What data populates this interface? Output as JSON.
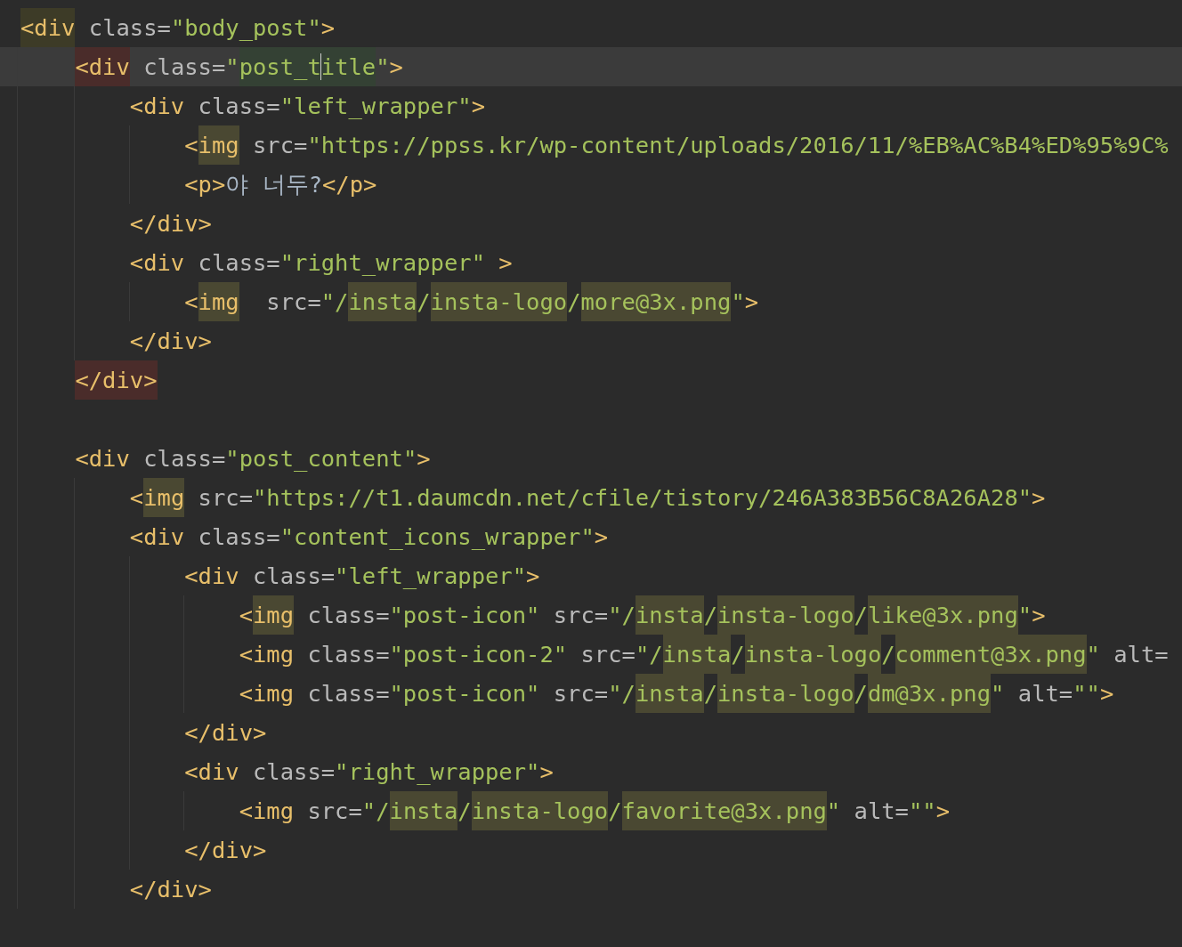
{
  "editor": {
    "lines": [
      {
        "current": false,
        "tokens": [
          {
            "kind": "tag",
            "text": "<div",
            "color": "#3d3b27"
          },
          {
            "kind": "attr",
            "text": " class="
          },
          {
            "kind": "str",
            "text": "\"body_post\""
          },
          {
            "kind": "tag",
            "text": ">"
          }
        ],
        "children": [
          {
            "current": true,
            "tokens": [
              {
                "kind": "tag",
                "text": "<div",
                "color": "#4a2c2a"
              },
              {
                "kind": "attr",
                "text": " class="
              },
              {
                "kind": "str",
                "text": "\""
              },
              {
                "kind": "str",
                "text": "post_t",
                "color": "#344134"
              },
              {
                "kind": "caret"
              },
              {
                "kind": "str",
                "text": "itle",
                "color": "#344134"
              },
              {
                "kind": "str",
                "text": "\""
              },
              {
                "kind": "tag",
                "text": ">"
              }
            ],
            "children": [
              {
                "current": false,
                "tokens": [
                  {
                    "kind": "tag",
                    "text": "<div"
                  },
                  {
                    "kind": "attr",
                    "text": " class="
                  },
                  {
                    "kind": "str",
                    "text": "\"left_wrapper\""
                  },
                  {
                    "kind": "tag",
                    "text": ">"
                  }
                ],
                "children": [
                  {
                    "current": false,
                    "tokens": [
                      {
                        "kind": "tag",
                        "text": "<"
                      },
                      {
                        "kind": "tag",
                        "text": "img",
                        "color": "#4a4832"
                      },
                      {
                        "kind": "attr",
                        "text": " src="
                      },
                      {
                        "kind": "str",
                        "text": "\"https://ppss.kr/wp-content/uploads/2016/11/%EB%AC%B4%ED%95%9C%"
                      }
                    ]
                  },
                  {
                    "current": false,
                    "tokens": [
                      {
                        "kind": "tag",
                        "text": "<p>"
                      },
                      {
                        "kind": "text",
                        "text": "야 너두?"
                      },
                      {
                        "kind": "tag",
                        "text": "</p>"
                      }
                    ]
                  }
                ]
              },
              {
                "current": false,
                "tokens": [
                  {
                    "kind": "tag",
                    "text": "</div>"
                  }
                ]
              },
              {
                "current": false,
                "tokens": [
                  {
                    "kind": "tag",
                    "text": "<div"
                  },
                  {
                    "kind": "attr",
                    "text": " class="
                  },
                  {
                    "kind": "str",
                    "text": "\"right_wrapper\""
                  },
                  {
                    "kind": "tag",
                    "text": " >"
                  }
                ],
                "children": [
                  {
                    "current": false,
                    "tokens": [
                      {
                        "kind": "tag",
                        "text": "<"
                      },
                      {
                        "kind": "tag",
                        "text": "img",
                        "color": "#4a4832"
                      },
                      {
                        "kind": "attr",
                        "text": "  src="
                      },
                      {
                        "kind": "str",
                        "text": "\"/"
                      },
                      {
                        "kind": "str",
                        "text": "insta",
                        "color": "#4a4832"
                      },
                      {
                        "kind": "str",
                        "text": "/"
                      },
                      {
                        "kind": "str",
                        "text": "insta-logo",
                        "color": "#4a4832"
                      },
                      {
                        "kind": "str",
                        "text": "/"
                      },
                      {
                        "kind": "str",
                        "text": "more@3x.png",
                        "color": "#4a4832"
                      },
                      {
                        "kind": "str",
                        "text": "\""
                      },
                      {
                        "kind": "tag",
                        "text": ">"
                      }
                    ]
                  }
                ]
              },
              {
                "current": false,
                "tokens": [
                  {
                    "kind": "tag",
                    "text": "</div>"
                  }
                ]
              }
            ]
          },
          {
            "current": false,
            "tokens": [
              {
                "kind": "tag",
                "text": "</div>",
                "color": "#4a2c2a"
              }
            ]
          },
          {
            "current": false
          },
          {
            "current": false,
            "tokens": [
              {
                "kind": "tag",
                "text": "<div"
              },
              {
                "kind": "attr",
                "text": " class="
              },
              {
                "kind": "str",
                "text": "\"post_content\""
              },
              {
                "kind": "tag",
                "text": ">"
              }
            ],
            "children": [
              {
                "current": false,
                "tokens": [
                  {
                    "kind": "tag",
                    "text": "<"
                  },
                  {
                    "kind": "tag",
                    "text": "img",
                    "color": "#4a4832"
                  },
                  {
                    "kind": "attr",
                    "text": " src="
                  },
                  {
                    "kind": "str",
                    "text": "\"https://t1.daumcdn.net/cfile/tistory/246A383B56C8A26A28\""
                  },
                  {
                    "kind": "tag",
                    "text": ">"
                  }
                ]
              },
              {
                "current": false,
                "tokens": [
                  {
                    "kind": "tag",
                    "text": "<div"
                  },
                  {
                    "kind": "attr",
                    "text": " class="
                  },
                  {
                    "kind": "str",
                    "text": "\"content_icons_wrapper\""
                  },
                  {
                    "kind": "tag",
                    "text": ">"
                  }
                ],
                "children": [
                  {
                    "current": false,
                    "tokens": [
                      {
                        "kind": "tag",
                        "text": "<div"
                      },
                      {
                        "kind": "attr",
                        "text": " class="
                      },
                      {
                        "kind": "str",
                        "text": "\"left_wrapper\""
                      },
                      {
                        "kind": "tag",
                        "text": ">"
                      }
                    ],
                    "children": [
                      {
                        "current": false,
                        "tokens": [
                          {
                            "kind": "tag",
                            "text": "<"
                          },
                          {
                            "kind": "tag",
                            "text": "img",
                            "color": "#4a4832"
                          },
                          {
                            "kind": "attr",
                            "text": " class="
                          },
                          {
                            "kind": "str",
                            "text": "\"post-icon\""
                          },
                          {
                            "kind": "attr",
                            "text": " src="
                          },
                          {
                            "kind": "str",
                            "text": "\"/"
                          },
                          {
                            "kind": "str",
                            "text": "insta",
                            "color": "#4a4832"
                          },
                          {
                            "kind": "str",
                            "text": "/"
                          },
                          {
                            "kind": "str",
                            "text": "insta-logo",
                            "color": "#4a4832"
                          },
                          {
                            "kind": "str",
                            "text": "/"
                          },
                          {
                            "kind": "str",
                            "text": "like@3x.png",
                            "color": "#4a4832"
                          },
                          {
                            "kind": "str",
                            "text": "\""
                          },
                          {
                            "kind": "tag",
                            "text": ">"
                          }
                        ]
                      },
                      {
                        "current": false,
                        "tokens": [
                          {
                            "kind": "tag",
                            "text": "<img"
                          },
                          {
                            "kind": "attr",
                            "text": " class="
                          },
                          {
                            "kind": "str",
                            "text": "\"post-icon-2\""
                          },
                          {
                            "kind": "attr",
                            "text": " src="
                          },
                          {
                            "kind": "str",
                            "text": "\"/"
                          },
                          {
                            "kind": "str",
                            "text": "insta",
                            "color": "#4a4832"
                          },
                          {
                            "kind": "str",
                            "text": "/"
                          },
                          {
                            "kind": "str",
                            "text": "insta-logo",
                            "color": "#4a4832"
                          },
                          {
                            "kind": "str",
                            "text": "/"
                          },
                          {
                            "kind": "str",
                            "text": "comment@3x.png",
                            "color": "#4a4832"
                          },
                          {
                            "kind": "str",
                            "text": "\""
                          },
                          {
                            "kind": "attr",
                            "text": " alt="
                          }
                        ]
                      },
                      {
                        "current": false,
                        "tokens": [
                          {
                            "kind": "tag",
                            "text": "<img"
                          },
                          {
                            "kind": "attr",
                            "text": " class="
                          },
                          {
                            "kind": "str",
                            "text": "\"post-icon\""
                          },
                          {
                            "kind": "attr",
                            "text": " src="
                          },
                          {
                            "kind": "str",
                            "text": "\"/"
                          },
                          {
                            "kind": "str",
                            "text": "insta",
                            "color": "#4a4832"
                          },
                          {
                            "kind": "str",
                            "text": "/"
                          },
                          {
                            "kind": "str",
                            "text": "insta-logo",
                            "color": "#4a4832"
                          },
                          {
                            "kind": "str",
                            "text": "/"
                          },
                          {
                            "kind": "str",
                            "text": "dm@3x.png",
                            "color": "#4a4832"
                          },
                          {
                            "kind": "str",
                            "text": "\""
                          },
                          {
                            "kind": "attr",
                            "text": " alt="
                          },
                          {
                            "kind": "str",
                            "text": "\"\""
                          },
                          {
                            "kind": "tag",
                            "text": ">"
                          }
                        ]
                      }
                    ]
                  },
                  {
                    "current": false,
                    "tokens": [
                      {
                        "kind": "tag",
                        "text": "</div>"
                      }
                    ]
                  },
                  {
                    "current": false,
                    "tokens": [
                      {
                        "kind": "tag",
                        "text": "<div"
                      },
                      {
                        "kind": "attr",
                        "text": " class="
                      },
                      {
                        "kind": "str",
                        "text": "\"right_wrapper\""
                      },
                      {
                        "kind": "tag",
                        "text": ">"
                      }
                    ],
                    "children": [
                      {
                        "current": false,
                        "tokens": [
                          {
                            "kind": "tag",
                            "text": "<img"
                          },
                          {
                            "kind": "attr",
                            "text": " src="
                          },
                          {
                            "kind": "str",
                            "text": "\"/"
                          },
                          {
                            "kind": "str",
                            "text": "insta",
                            "color": "#4a4832"
                          },
                          {
                            "kind": "str",
                            "text": "/"
                          },
                          {
                            "kind": "str",
                            "text": "insta-logo",
                            "color": "#4a4832"
                          },
                          {
                            "kind": "str",
                            "text": "/"
                          },
                          {
                            "kind": "str",
                            "text": "favorite@3x.png",
                            "color": "#4a4832"
                          },
                          {
                            "kind": "str",
                            "text": "\""
                          },
                          {
                            "kind": "attr",
                            "text": " alt="
                          },
                          {
                            "kind": "str",
                            "text": "\"\""
                          },
                          {
                            "kind": "tag",
                            "text": ">"
                          }
                        ]
                      }
                    ]
                  },
                  {
                    "current": false,
                    "tokens": [
                      {
                        "kind": "tag",
                        "text": "</div>"
                      }
                    ]
                  }
                ]
              },
              {
                "current": false,
                "tokens": [
                  {
                    "kind": "tag",
                    "text": "</div>"
                  }
                ]
              }
            ]
          }
        ]
      }
    ]
  }
}
